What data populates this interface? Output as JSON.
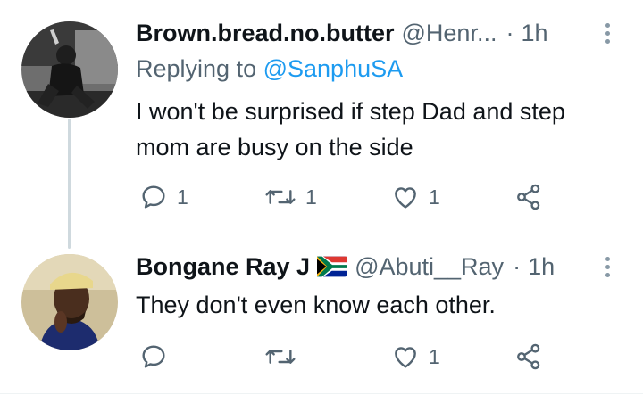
{
  "tweets": [
    {
      "display_name": "Brown.bread.no.butter",
      "handle": "@Henr...",
      "separator": "·",
      "time": "1h",
      "replying_prefix": "Replying to",
      "replying_to": "@SanphuSA",
      "text_line1": "I won't be surprised if step Dad and step",
      "text_line2": "mom are busy on the side",
      "reply_count": "1",
      "retweet_count": "1",
      "like_count": "1"
    },
    {
      "display_name": "Bongane Ray J",
      "flag_icon": "south-africa-flag-icon",
      "handle": "@Abuti__Ray",
      "separator": "·",
      "time": "1h",
      "text": "They don't even know each other.",
      "like_count": "1"
    }
  ],
  "colors": {
    "text_primary": "#0f1419",
    "text_secondary": "#536471",
    "link": "#1d9bf0",
    "thread_line": "#cfd9de"
  }
}
